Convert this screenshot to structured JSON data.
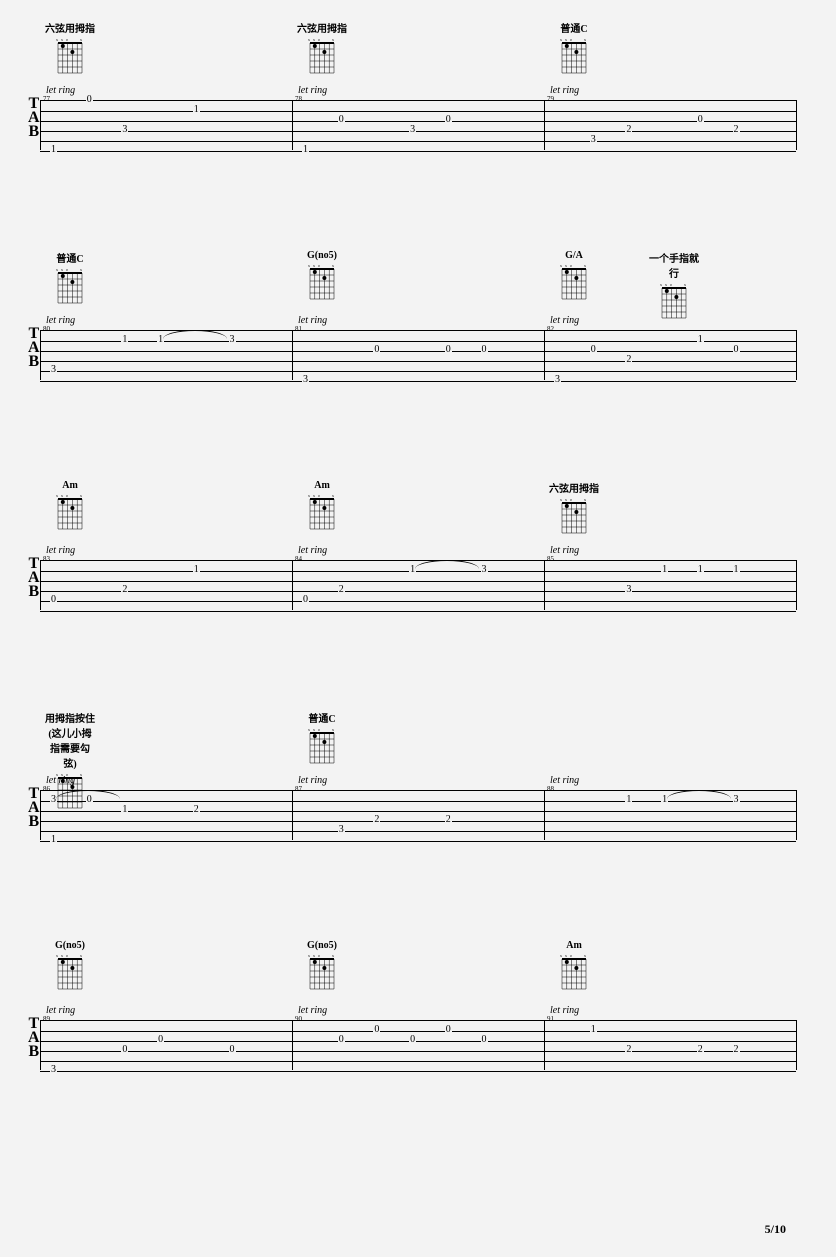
{
  "page_number": "5/10",
  "chart_data": {
    "type": "guitar_tablature",
    "tuning": "standard",
    "systems": [
      {
        "measures": [
          {
            "num": "77",
            "chord": "六弦用拇指",
            "let_ring": true,
            "notes": [
              {
                "str": 6,
                "fret": "1",
                "pos": 0
              },
              {
                "str": 1,
                "fret": "0",
                "pos": 1
              },
              {
                "str": 4,
                "fret": "3",
                "pos": 2
              },
              {
                "str": 2,
                "fret": "1",
                "pos": 4
              }
            ]
          },
          {
            "num": "78",
            "chord": "六弦用拇指",
            "let_ring": true,
            "notes": [
              {
                "str": 6,
                "fret": "1",
                "pos": 0
              },
              {
                "str": 3,
                "fret": "0",
                "pos": 1
              },
              {
                "str": 4,
                "fret": "3",
                "pos": 3
              },
              {
                "str": 3,
                "fret": "0",
                "pos": 4
              }
            ]
          },
          {
            "num": "79",
            "chord": "普通C",
            "let_ring": true,
            "notes": [
              {
                "str": 5,
                "fret": "3",
                "pos": 1
              },
              {
                "str": 4,
                "fret": "2",
                "pos": 2
              },
              {
                "str": 3,
                "fret": "0",
                "pos": 4
              },
              {
                "str": 4,
                "fret": "2",
                "pos": 5
              }
            ]
          }
        ]
      },
      {
        "measures": [
          {
            "num": "80",
            "chord": "普通C",
            "let_ring": true,
            "notes": [
              {
                "str": 5,
                "fret": "3",
                "pos": 0
              },
              {
                "str": 2,
                "fret": "1",
                "pos": 2
              },
              {
                "str": 2,
                "fret": "1",
                "pos": 3,
                "tie_to_next": true
              },
              {
                "str": 2,
                "fret": "3",
                "pos": 5
              }
            ]
          },
          {
            "num": "81",
            "chord": "G(no5)",
            "let_ring": true,
            "notes": [
              {
                "str": 6,
                "fret": "3",
                "pos": 0
              },
              {
                "str": 3,
                "fret": "0",
                "pos": 2
              },
              {
                "str": 3,
                "fret": "0",
                "pos": 4
              },
              {
                "str": 3,
                "fret": "0",
                "pos": 5
              }
            ]
          },
          {
            "num": "82",
            "chords": [
              "G/A",
              "一个手指就行"
            ],
            "let_ring": true,
            "notes": [
              {
                "str": 6,
                "fret": "3",
                "pos": 0
              },
              {
                "str": 3,
                "fret": "0",
                "pos": 1
              },
              {
                "str": 4,
                "fret": "2",
                "pos": 2
              },
              {
                "str": 2,
                "fret": "1",
                "pos": 4
              },
              {
                "str": 3,
                "fret": "0",
                "pos": 5
              }
            ]
          }
        ]
      },
      {
        "measures": [
          {
            "num": "83",
            "chord": "Am",
            "let_ring": true,
            "notes": [
              {
                "str": 5,
                "fret": "0",
                "pos": 0
              },
              {
                "str": 4,
                "fret": "2",
                "pos": 2
              },
              {
                "str": 2,
                "fret": "1",
                "pos": 4
              }
            ]
          },
          {
            "num": "84",
            "chord": "Am",
            "let_ring": true,
            "notes": [
              {
                "str": 5,
                "fret": "0",
                "pos": 0
              },
              {
                "str": 4,
                "fret": "2",
                "pos": 1
              },
              {
                "str": 2,
                "fret": "1",
                "pos": 3,
                "tie_to_next": true
              },
              {
                "str": 2,
                "fret": "3",
                "pos": 5
              }
            ]
          },
          {
            "num": "85",
            "chord": "六弦用拇指",
            "let_ring": true,
            "notes": [
              {
                "str": 4,
                "fret": "3",
                "pos": 2
              },
              {
                "str": 2,
                "fret": "1",
                "pos": 3
              },
              {
                "str": 2,
                "fret": "1",
                "pos": 4
              },
              {
                "str": 2,
                "fret": "1",
                "pos": 5
              }
            ]
          }
        ]
      },
      {
        "measures": [
          {
            "num": "86",
            "chord": "用拇指按住(这儿小拇指需要勾弦)",
            "let_ring": true,
            "notes": [
              {
                "str": 6,
                "fret": "1",
                "pos": 0
              },
              {
                "str": 2,
                "fret": "3",
                "pos": 0,
                "tie_to_next": true
              },
              {
                "str": 2,
                "fret": "0",
                "pos": 1
              },
              {
                "str": 3,
                "fret": "1",
                "pos": 2
              },
              {
                "str": 3,
                "fret": "2",
                "pos": 4
              }
            ]
          },
          {
            "num": "87",
            "chord": "普通C",
            "let_ring": true,
            "notes": [
              {
                "str": 5,
                "fret": "3",
                "pos": 1
              },
              {
                "str": 4,
                "fret": "2",
                "pos": 2
              },
              {
                "str": 4,
                "fret": "2",
                "pos": 4
              }
            ]
          },
          {
            "num": "88",
            "let_ring": true,
            "notes": [
              {
                "str": 2,
                "fret": "1",
                "pos": 2
              },
              {
                "str": 2,
                "fret": "1",
                "pos": 3,
                "tie_to_next": true
              },
              {
                "str": 2,
                "fret": "3",
                "pos": 5
              }
            ]
          }
        ]
      },
      {
        "measures": [
          {
            "num": "89",
            "chord": "G(no5)",
            "let_ring": true,
            "notes": [
              {
                "str": 6,
                "fret": "3",
                "pos": 0
              },
              {
                "str": 4,
                "fret": "0",
                "pos": 2
              },
              {
                "str": 3,
                "fret": "0",
                "pos": 3
              },
              {
                "str": 4,
                "fret": "0",
                "pos": 5
              }
            ]
          },
          {
            "num": "90",
            "chord": "G(no5)",
            "let_ring": true,
            "notes": [
              {
                "str": 3,
                "fret": "0",
                "pos": 1
              },
              {
                "str": 2,
                "fret": "0",
                "pos": 2
              },
              {
                "str": 3,
                "fret": "0",
                "pos": 3
              },
              {
                "str": 2,
                "fret": "0",
                "pos": 4
              },
              {
                "str": 3,
                "fret": "0",
                "pos": 5
              }
            ]
          },
          {
            "num": "91",
            "chord": "Am",
            "let_ring": true,
            "notes": [
              {
                "str": 2,
                "fret": "1",
                "pos": 1
              },
              {
                "str": 4,
                "fret": "2",
                "pos": 2
              },
              {
                "str": 4,
                "fret": "2",
                "pos": 4
              },
              {
                "str": 4,
                "fret": "2",
                "pos": 5
              }
            ]
          }
        ]
      }
    ]
  },
  "labels": {
    "tab": "T\nA\nB",
    "let_ring": "let ring"
  }
}
